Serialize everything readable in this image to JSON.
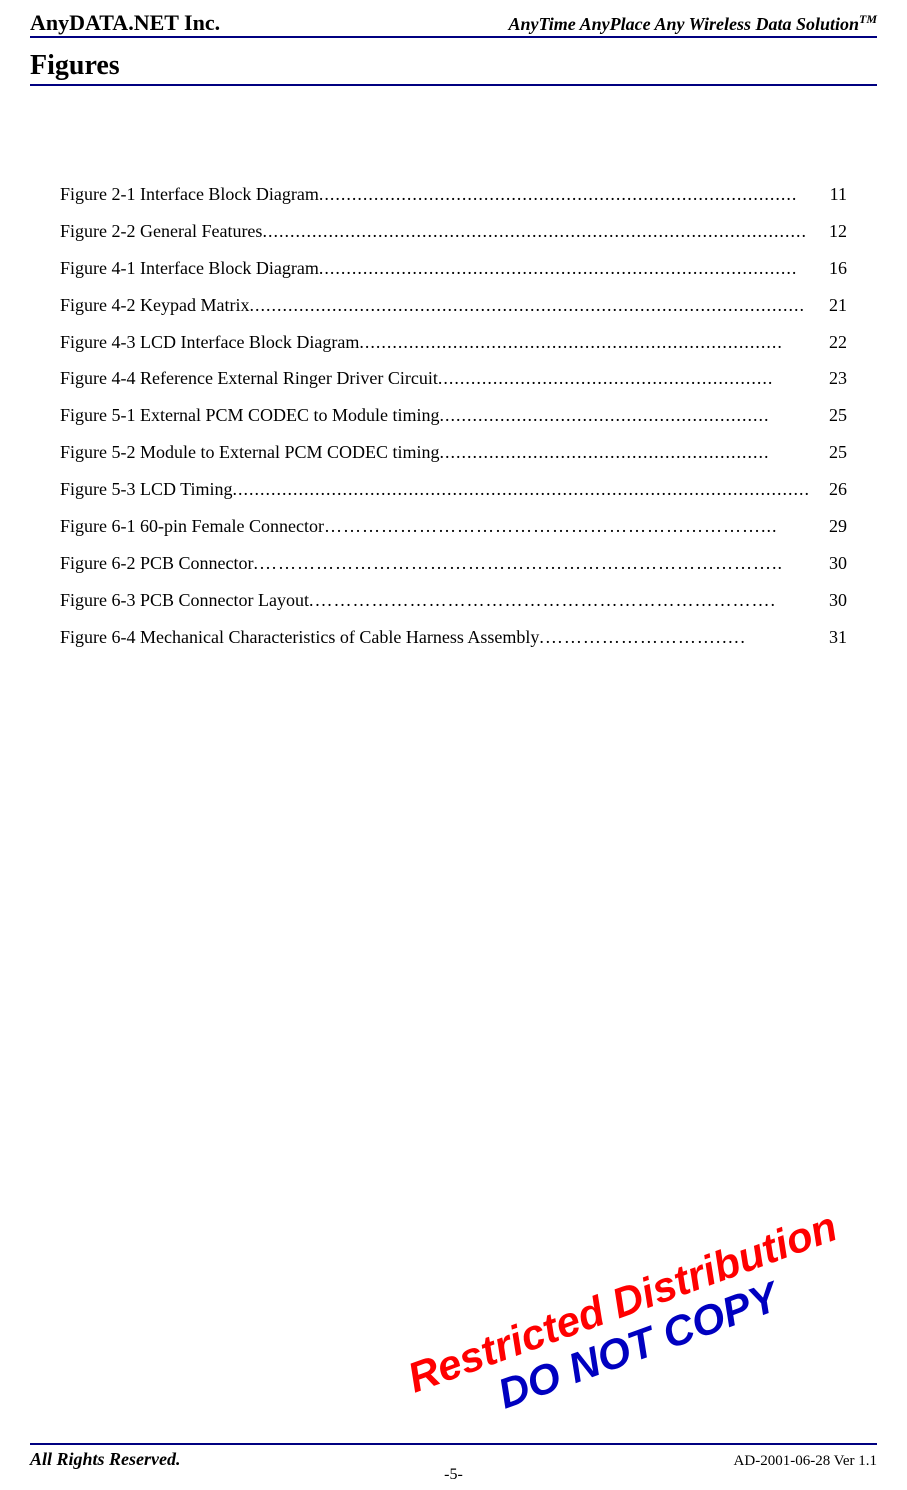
{
  "header": {
    "company": "AnyDATA.NET Inc.",
    "tagline_main": "AnyTime AnyPlace Any Wireless Data Solution",
    "tagline_tm": "TM"
  },
  "section_title": "Figures",
  "toc": [
    {
      "label": "Figure 2-1 Interface Block Diagram",
      "dots": "  .......................................................................................",
      "page": "11"
    },
    {
      "label": "Figure 2-2 General Features",
      "dots": "   ...................................................................................................",
      "page": "12"
    },
    {
      "label": "Figure 4-1 Interface Block Diagram",
      "dots": "  .......................................................................................",
      "page": "16"
    },
    {
      "label": "Figure 4-2 Keypad Matrix",
      "dots": "   .....................................................................................................",
      "page": "21"
    },
    {
      "label": "Figure 4-3 LCD Interface Block Diagram",
      "dots": "  .............................................................................",
      "page": "22"
    },
    {
      "label": "Figure 4-4 Reference External Ringer Driver Circuit",
      "dots": "  .............................................................",
      "page": "23"
    },
    {
      "label": "Figure 5-1 External PCM CODEC to Module timing",
      "dots": "   ............................................................",
      "page": "25"
    },
    {
      "label": "Figure 5-2 Module to External PCM CODEC timing",
      "dots": "   ............................................................",
      "page": "25"
    },
    {
      "label": "Figure 5-3 LCD Timing",
      "dots": "  .........................................................................................................",
      "page": "26"
    },
    {
      "label": "Figure 6-1 60-pin Female Connector",
      "dots": " ……………………………………………………………... ",
      "page": "29"
    },
    {
      "label": "Figure 6-2 PCB Connector",
      "dots": " .………………………………………………………………………..",
      "page": "30"
    },
    {
      "label": "Figure 6-3 PCB Connector Layout",
      "dots": " .………………………………………………………………. ",
      "page": "30"
    },
    {
      "label": "Figure 6-4 Mechanical Characteristics of Cable Harness Assembly",
      "dots": " .……………………….…. ",
      "page": "31"
    }
  ],
  "watermark": {
    "line1": "Restricted Distribution",
    "line2": "DO NOT COPY"
  },
  "footer": {
    "left": "All Rights Reserved.",
    "center": "-5-",
    "right": "AD-2001-06-28 Ver 1.1"
  }
}
